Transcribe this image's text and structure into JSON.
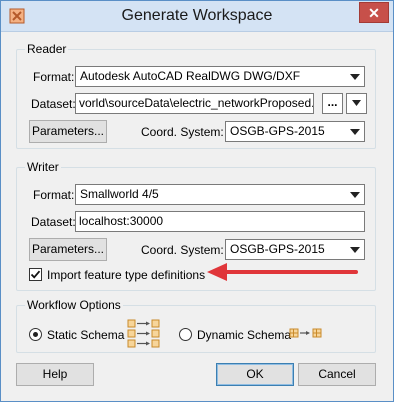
{
  "window": {
    "title": "Generate Workspace",
    "close_glyph": "✕"
  },
  "reader": {
    "group_title": "Reader",
    "format_label": "Format:",
    "format_value": "Autodesk AutoCAD RealDWG DWG/DXF",
    "dataset_label": "Dataset:",
    "dataset_value": "vorld\\sourceData\\electric_networkProposed.dwg",
    "browse_label": "...",
    "parameters_label": "Parameters...",
    "coord_label": "Coord. System:",
    "coord_value": "OSGB-GPS-2015"
  },
  "writer": {
    "group_title": "Writer",
    "format_label": "Format:",
    "format_value": "Smallworld 4/5",
    "dataset_label": "Dataset:",
    "dataset_value": "localhost:30000",
    "parameters_label": "Parameters...",
    "coord_label": "Coord. System:",
    "coord_value": "OSGB-GPS-2015",
    "import_checkbox_label": "Import feature type definitions",
    "import_checked": true
  },
  "workflow": {
    "group_title": "Workflow Options",
    "static_label": "Static Schema",
    "dynamic_label": "Dynamic Schema",
    "selected": "static"
  },
  "buttons": {
    "help": "Help",
    "ok": "OK",
    "cancel": "Cancel"
  },
  "colors": {
    "arrow": "#e0363a",
    "close": "#c7504a",
    "schema_icon": "#c98a2b"
  },
  "icons": {
    "app": "fme-app-icon",
    "dropdown": "chevron-down-icon",
    "arrow": "red-arrow-annotation"
  }
}
